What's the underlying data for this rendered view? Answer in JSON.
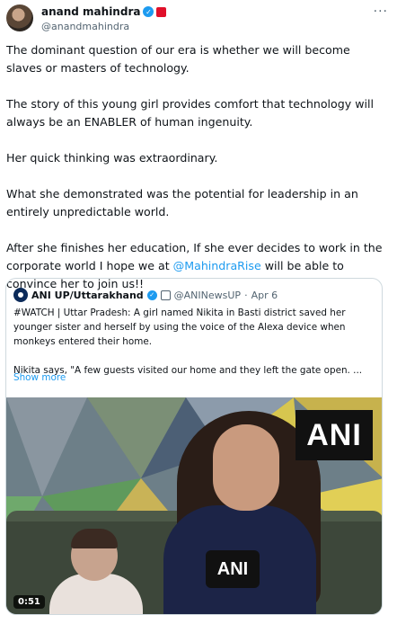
{
  "author": {
    "display_name": "anand mahindra",
    "handle": "@anandmahindra",
    "verified_icon": "check-badge-icon",
    "affiliate_icon": "red-square-badge-icon",
    "more_label": "···"
  },
  "tweet": {
    "p1": "The dominant question of our era is whether we will become slaves or masters of technology.",
    "p2": "The story of this young girl provides comfort that technology will always be an ENABLER of human ingenuity.",
    "p3": "Her quick thinking was extraordinary.",
    "p4": "What she demonstrated was the potential for leadership in an entirely unpredictable world.",
    "p5_before": "After she finishes her education, If she ever decides to work in the corporate world I hope we at ",
    "p5_mention": "@MahindraRise",
    "p5_after": " will be able to convince her to join us!!"
  },
  "quote": {
    "name": "ANI UP/Uttarakhand",
    "handle": "@ANINewsUP",
    "separator": "·",
    "date": "Apr 6",
    "text1": "#WATCH | Uttar Pradesh: A girl named Nikita in Basti district saved her younger sister and herself by using the voice of the Alexa device when monkeys entered their home.",
    "text2": "Nikita says, \"A few guests visited our home and they left the gate open. ...",
    "show_more": "Show more",
    "video": {
      "logo_text": "ANI",
      "mic_text": "ANI",
      "duration": "0:51"
    }
  },
  "colors": {
    "accent": "#1d9bf0",
    "text": "#0f1419",
    "muted": "#536471",
    "border": "#cfd9de"
  }
}
